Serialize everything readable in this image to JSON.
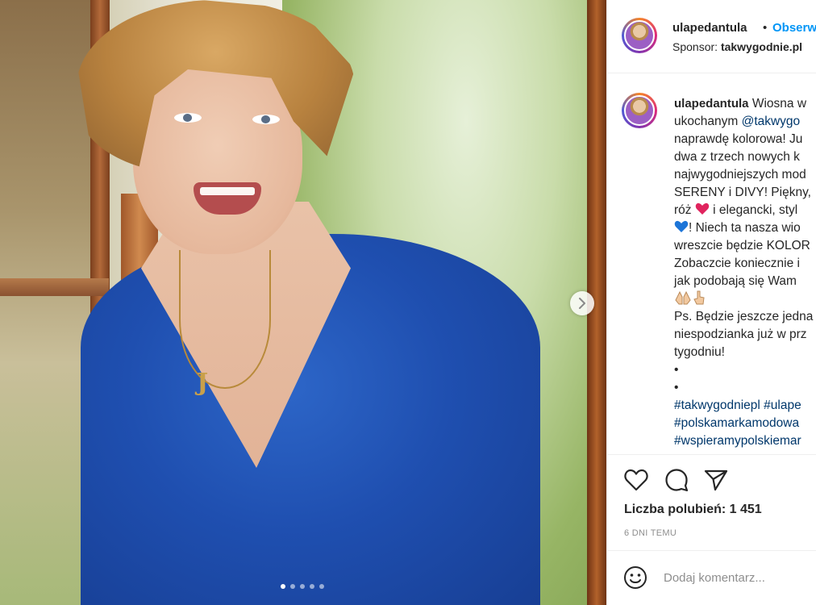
{
  "post": {
    "author": "ulapedantula",
    "separator": "•",
    "follow_label": "Obserwuj",
    "sponsor_prefix": "Sponsor:",
    "sponsor_name": "takwygodnie.pl",
    "carousel": {
      "slide_count": 5,
      "active_index": 0
    }
  },
  "caption": {
    "author": "ulapedantula",
    "lines": [
      " Wiosna w",
      "ukochanym ",
      "naprawdę kolorowa! Ju",
      "dwa z trzech nowych k",
      "najwygodniejszych mod",
      "SERENY i DIVY! Piękny,",
      "róż ",
      "! Niech ta nasza wio",
      "wreszcie będzie KOLOR",
      "Zobaczcie koniecznie i",
      "jak podobają się Wam",
      "",
      "Ps. Będzie jeszcze jedna",
      "niespodzianka już w prz",
      "tygodniu!",
      "•",
      "•"
    ],
    "mention": "@takwygo",
    "line7_rest": " i elegancki, styl",
    "hashtags": [
      "#takwygodniepl #ulape",
      "#polskamarkamodowa",
      "#wspieramypolskiemar"
    ]
  },
  "actions": {
    "like_icon": "heart-icon",
    "comment_icon": "comment-icon",
    "share_icon": "send-icon",
    "likes_label": "Liczba polubień: 1 451",
    "time_label": "6 DNI TEMU"
  },
  "comment": {
    "emoji_icon": "smile-icon",
    "placeholder": "Dodaj komentarz..."
  },
  "colors": {
    "follow": "#0095f6",
    "link": "#00376b",
    "muted": "#8e8e8e",
    "dress": "#1f4fb0"
  }
}
